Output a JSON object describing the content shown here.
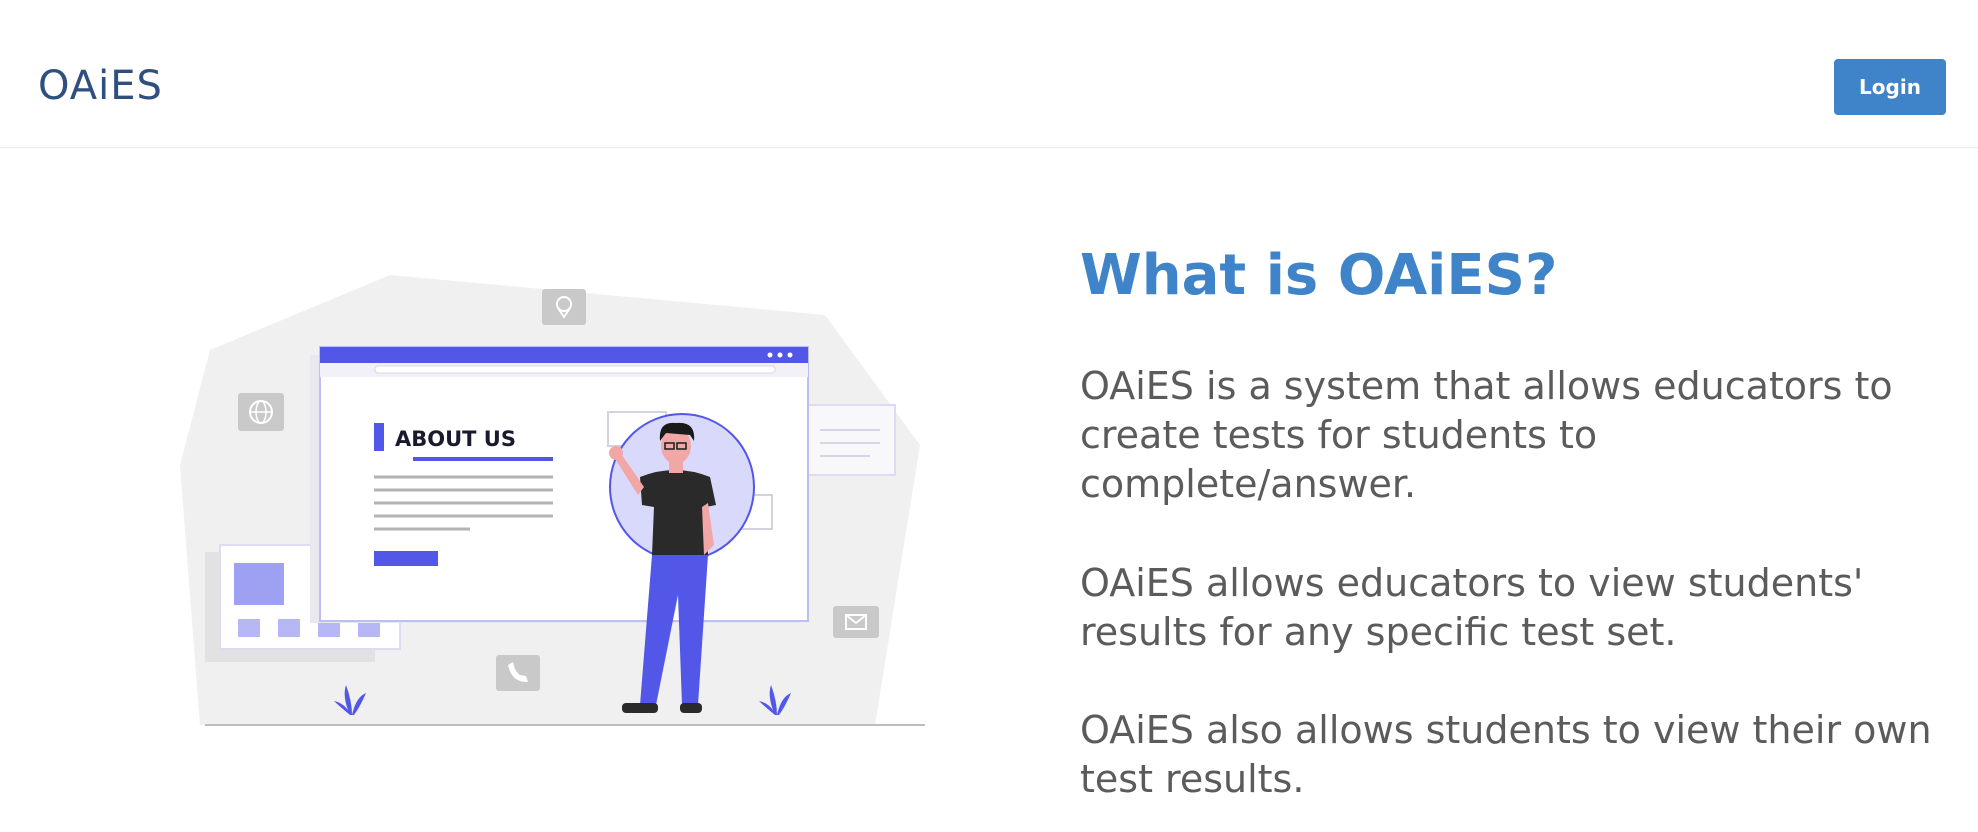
{
  "header": {
    "brand": "OAiES",
    "login_label": "Login"
  },
  "illustration": {
    "panel_heading": "ABOUT US"
  },
  "main": {
    "title": "What is OAiES?",
    "paragraphs": [
      "OAiES is a system that allows educators to create tests for students to complete/answer.",
      "OAiES allows educators to view students' results for any specific test set.",
      "OAiES also allows students to view their own test results."
    ]
  },
  "colors": {
    "accent": "#3f83c8",
    "brand": "#2f4f7f",
    "illustration_primary": "#5357e8",
    "body_text": "#5b5b5b"
  }
}
